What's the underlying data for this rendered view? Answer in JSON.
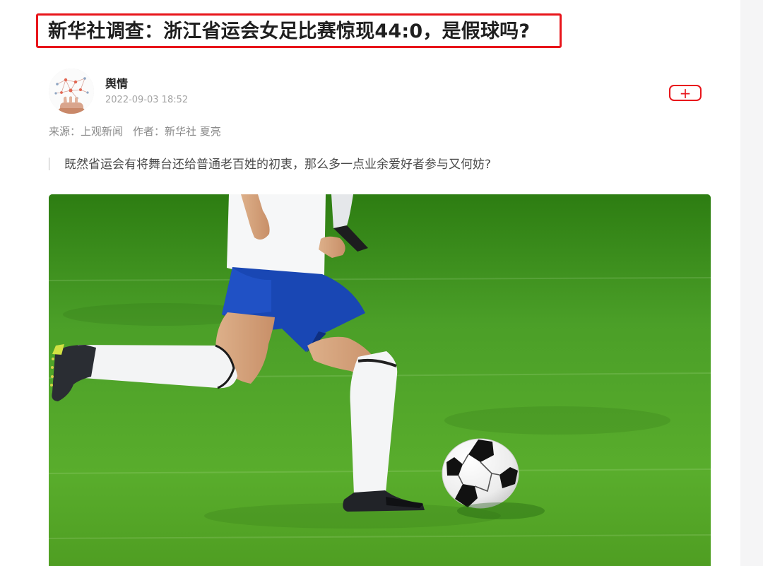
{
  "article": {
    "title": "新华社调查：浙江省运会女足比赛惊现44:0，是假球吗?",
    "author_name": "舆情",
    "publish_time": "2022-09-03 18:52",
    "source_label": "来源：上观新闻",
    "author_label": "作者：新华社 夏亮",
    "summary": "既然省运会有将舞台还给普通老百姓的初衷，那么多一点业余爱好者参与又何妨?",
    "follow_button_icon": "plus-icon"
  },
  "colors": {
    "highlight": "#e8151b",
    "title_text": "#1f1f1f",
    "meta_text": "#a3a3a3",
    "summary_text": "#4a4a4a",
    "grass": "#4f9e2a",
    "shorts": "#1947b4"
  },
  "image": {
    "description_icon": "soccer-player-photo"
  }
}
